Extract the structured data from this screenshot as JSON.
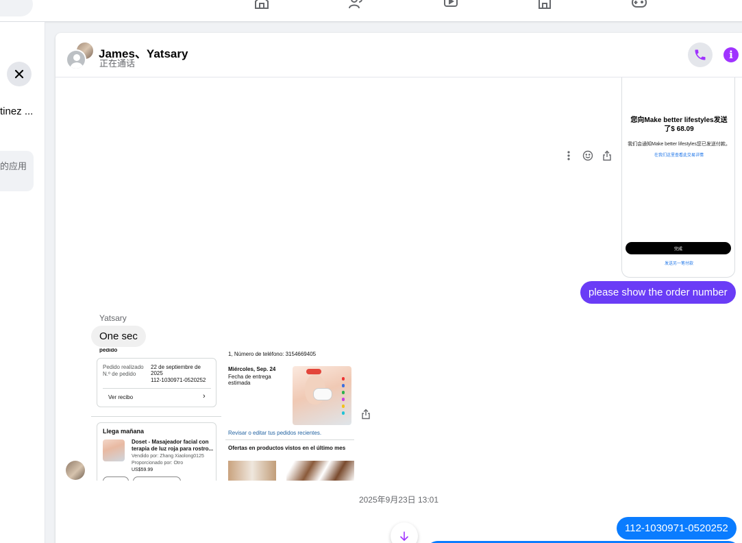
{
  "colors": {
    "accent_purple": "#a033ff",
    "outgoing_bubble": "#6a3cf6",
    "incoming_bubble": "#f0f0f0",
    "blue_bubble": "#0a7cff"
  },
  "topnav": {
    "icons": [
      "home-icon",
      "friends-icon",
      "video-icon",
      "marketplace-icon",
      "gaming-icon"
    ]
  },
  "sidebar": {
    "truncated_name": "tinez ...",
    "card_text": "的应用"
  },
  "header": {
    "title": "James、Yatsary",
    "subtitle": "正在通话"
  },
  "payment_image": {
    "title": "您向Make better lifestyles发送了$ 68.09",
    "note": "我们会通知Make better lifestyles您已发送付款。",
    "link": "在我们这里查看此交易详情",
    "done_button": "完成",
    "send_again": "发送另一笔付款"
  },
  "messages": {
    "outgoing_1": "please show the order number",
    "sender_name": "Yatsary",
    "incoming_1": "One sec",
    "timestamp": "2025年9月23日 13:01",
    "outgoing_2": "112-1030971-0520252"
  },
  "order_image": {
    "top_left_partial": "pedido",
    "order_placed_label": "Pedido realizado",
    "order_no_label": "N.º de pedido",
    "order_date": "22 de septiembre de 2025",
    "order_number": "112-1030971-0520252",
    "receipt_link": "Ver recibo",
    "arriving": "Llega mañana",
    "product_name": "Doset - Masajeador facial con terapia de luz roja para rostro...",
    "sold_by": "Vendido por: Zhang Xiaolong0125",
    "supplied_by": "Proporcionado por: Otro",
    "price": "US$59.99",
    "address_line": "1, Número de teléfono: 3154669405",
    "delivery_day": "Miércoles, Sep. 24",
    "delivery_label": "Fecha de entrega estimada",
    "edit_link": "Revisar o editar tus pedidos recientes.",
    "offers_title": "Ofertas en productos vistos en el último mes"
  }
}
